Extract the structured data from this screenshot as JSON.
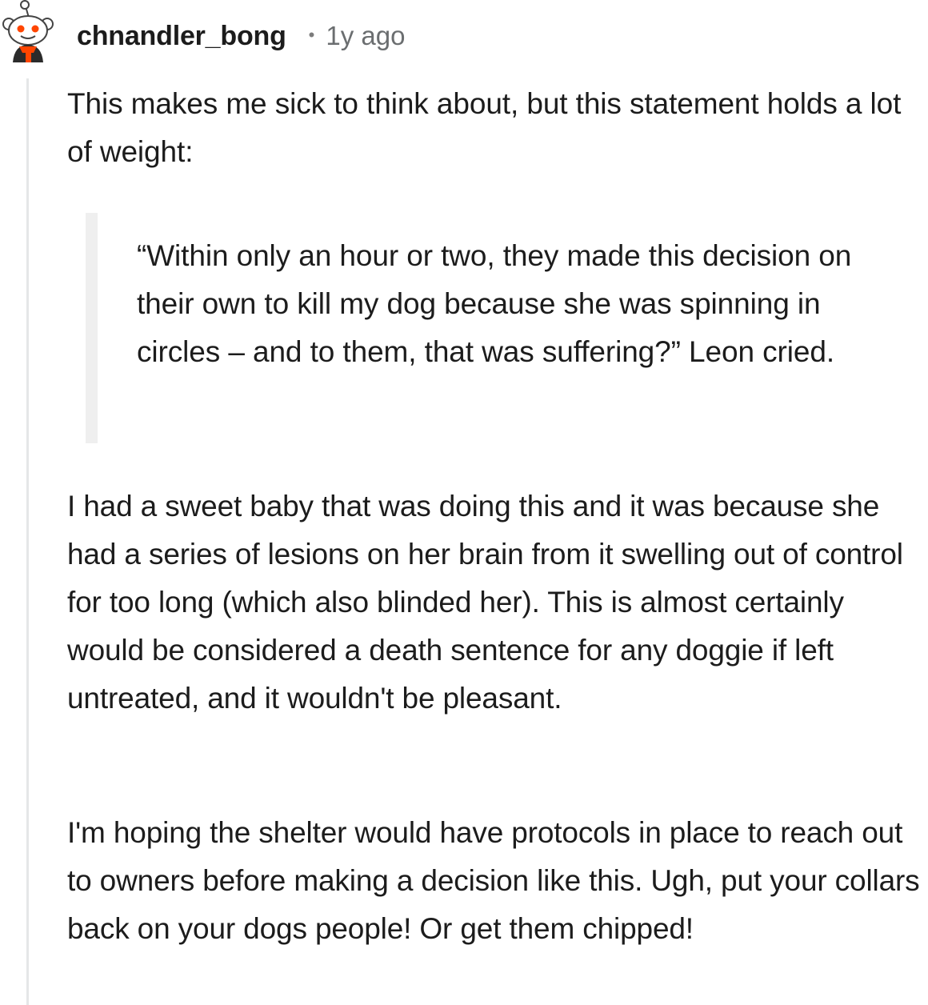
{
  "comment": {
    "username": "chnandler_bong",
    "separator": "•",
    "timestamp": "1y ago",
    "avatar_icon": "snoo-avatar-icon",
    "paragraphs": {
      "intro": "This makes me sick to think about, but this statement holds a lot of weight:",
      "quote": "“Within only an hour or two, they made this decision on their own to kill my dog because she was spinning in circles – and to them, that was suffering?” Leon cried.",
      "second": "I had a sweet baby that was doing this and it was because she had a series of lesions on her brain from it swelling out of control for too long (which also blinded her). This is almost certainly would be considered a death sentence for any doggie if left untreated, and it wouldn't be pleasant.",
      "third": "I'm hoping the shelter would have protocols in place to reach out to owners before making a decision like this. Ugh, put your collars back on your dogs people! Or get them chipped!"
    }
  },
  "colors": {
    "text": "#1c1c1c",
    "meta": "#6b6e70",
    "thread_line": "#e5e7e8",
    "quote_bar": "#efefef",
    "avatar_accent": "#ff4500"
  }
}
